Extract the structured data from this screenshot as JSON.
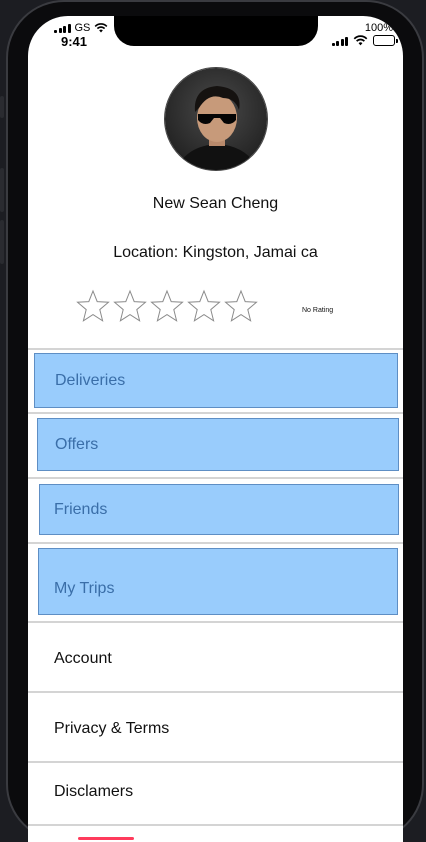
{
  "status": {
    "carrier": "GS",
    "time": "9:41",
    "battery": "100%"
  },
  "profile": {
    "name": "New Sean Cheng",
    "location": "Location: Kingston, Jamai ca",
    "rating_text": "No Rating",
    "rating_value": 0,
    "rating_max": 5
  },
  "menu": {
    "deliveries": "Deliveries",
    "offers": "Offers",
    "friends": "Friends",
    "my_trips": "My Trips",
    "account": "Account",
    "privacy": "Privacy & Terms",
    "disclaimers": "Disclamers"
  },
  "colors": {
    "menu_box_bg": "#99ccfc",
    "menu_box_text": "#3a6ea8",
    "home_indicator": "#ff3b5c"
  }
}
